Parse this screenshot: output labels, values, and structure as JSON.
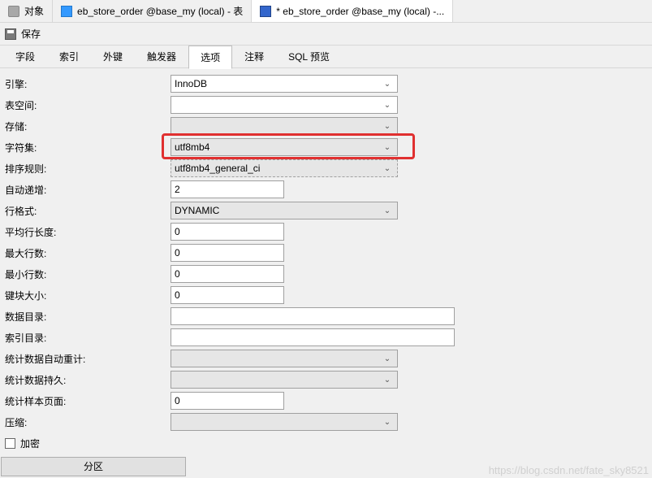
{
  "top_tabs": {
    "object": "对象",
    "tab1": "eb_store_order @base_my (local) - 表",
    "tab2": "* eb_store_order @base_my (local) -..."
  },
  "toolbar": {
    "save": "保存"
  },
  "sub_tabs": {
    "fields": "字段",
    "indexes": "索引",
    "fk": "外键",
    "triggers": "触发器",
    "options": "选项",
    "comment": "注释",
    "sql": "SQL 预览"
  },
  "labels": {
    "engine": "引擎:",
    "tablespace": "表空间:",
    "storage": "存储:",
    "charset": "字符集:",
    "collation": "排序规则:",
    "auto_increment": "自动递增:",
    "row_format": "行格式:",
    "avg_row_len": "平均行长度:",
    "max_rows": "最大行数:",
    "min_rows": "最小行数:",
    "key_block": "键块大小:",
    "data_dir": "数据目录:",
    "index_dir": "索引目录:",
    "stats_auto": "统计数据自动重计:",
    "stats_persist": "统计数据持久:",
    "stats_sample": "统计样本页面:",
    "compress": "压缩:",
    "encrypt": "加密",
    "partition": "分区"
  },
  "values": {
    "engine": "InnoDB",
    "tablespace": "",
    "storage": "",
    "charset": "utf8mb4",
    "collation": "utf8mb4_general_ci",
    "auto_increment": "2",
    "row_format": "DYNAMIC",
    "avg_row_len": "0",
    "max_rows": "0",
    "min_rows": "0",
    "key_block": "0",
    "data_dir": "",
    "index_dir": "",
    "stats_auto": "",
    "stats_persist": "",
    "stats_sample": "0",
    "compress": ""
  },
  "watermark": "https://blog.csdn.net/fate_sky8521"
}
